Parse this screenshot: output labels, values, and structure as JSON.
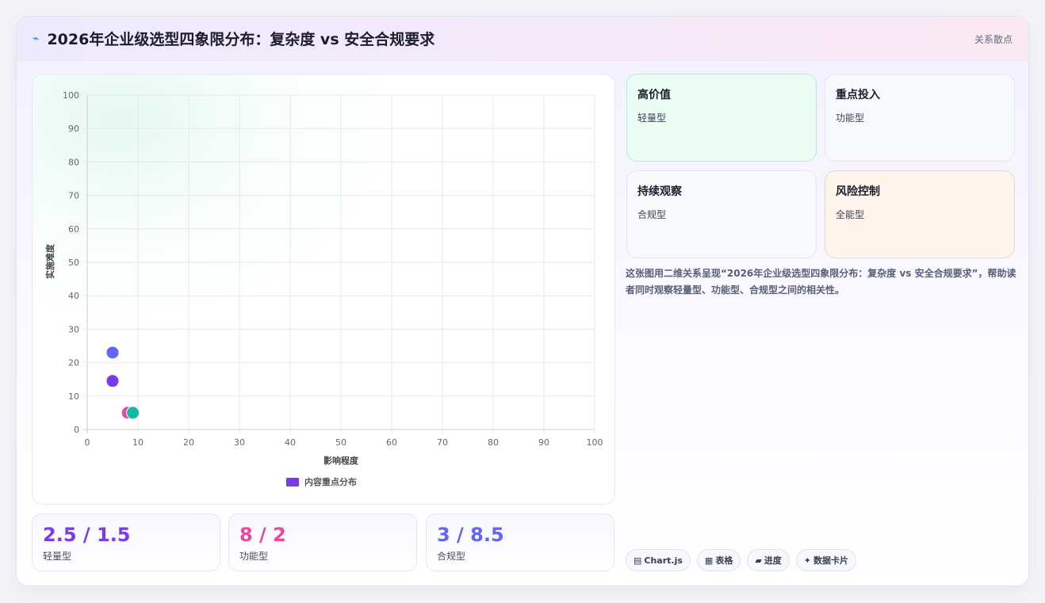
{
  "header": {
    "icon": "⌁",
    "title": "2026年企业级选型四象限分布：复杂度 vs 安全合规要求",
    "tag": "关系散点"
  },
  "chart_data": {
    "type": "scatter",
    "xlabel": "影响程度",
    "ylabel": "实施难度",
    "xlim": [
      0,
      100
    ],
    "ylim": [
      0,
      100
    ],
    "xticks": [
      0,
      10,
      20,
      30,
      40,
      50,
      60,
      70,
      80,
      90,
      100
    ],
    "yticks": [
      0,
      10,
      20,
      30,
      40,
      50,
      60,
      70,
      80,
      90,
      100
    ],
    "grid": true,
    "legend": {
      "placement": "bottom",
      "entries": [
        {
          "name": "内容重点分布",
          "color": "#7c3aed"
        }
      ]
    },
    "points": [
      {
        "x": 5,
        "y": 23,
        "color": "#6366f1"
      },
      {
        "x": 5,
        "y": 14.5,
        "color": "#7c3aed"
      },
      {
        "x": 8,
        "y": 5,
        "color": "#ec4899"
      },
      {
        "x": 9,
        "y": 5,
        "color": "#14b8a6"
      }
    ]
  },
  "stats": [
    {
      "value": "2.5 / 1.5",
      "label": "轻量型",
      "color": "#7c3aed"
    },
    {
      "value": "8 / 2",
      "label": "功能型",
      "color": "#ec4899"
    },
    {
      "value": "3 / 8.5",
      "label": "合规型",
      "color": "#6366f1"
    }
  ],
  "quadrants": [
    {
      "title": "高价值",
      "sub": "轻量型"
    },
    {
      "title": "重点投入",
      "sub": "功能型"
    },
    {
      "title": "持续观察",
      "sub": "合规型"
    },
    {
      "title": "风险控制",
      "sub": "全能型"
    }
  ],
  "description": "这张图用二维关系呈现“2026年企业级选型四象限分布：复杂度 vs 安全合规要求”，帮助读者同时观察轻量型、功能型、合规型之间的相关性。",
  "pills": [
    {
      "icon": "▤",
      "label": "Chart.js"
    },
    {
      "icon": "▦",
      "label": "表格"
    },
    {
      "icon": "▰",
      "label": "进度"
    },
    {
      "icon": "✦",
      "label": "数据卡片"
    }
  ]
}
